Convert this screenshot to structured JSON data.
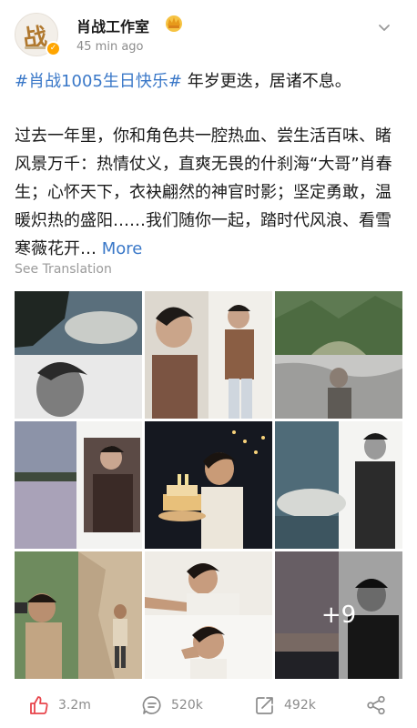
{
  "account": {
    "name": "肖战工作室",
    "time": "45 min ago",
    "avatar_glyph": "战"
  },
  "post": {
    "hashtag": "#肖战1005生日快乐#",
    "headline_rest": " 年岁更迭，居诸不息。",
    "body": "过去一年里，你和角色共一腔热血、尝生活百味、睹风景万千：热情仗义，直爽无畏的什刹海“大哥”肖春生；心怀天下，衣袂翩然的神官时影；坚定勇敢，温暖炽热的盛阳……我们随你一起，踏时代风浪、看雪寒薇花开…",
    "more_label": "More",
    "translate_label": "See Translation"
  },
  "media": {
    "extra_count_label": "+9"
  },
  "actions": {
    "likes": "3.2m",
    "comments": "520k",
    "reposts": "492k"
  },
  "colors": {
    "link": "#3a78c8",
    "like": "#e8454c",
    "verified": "#ffa500"
  },
  "icons": [
    "verified-icon",
    "crown-icon",
    "chevron-down-icon",
    "like-icon",
    "comment-icon",
    "repost-icon",
    "share-icon"
  ]
}
